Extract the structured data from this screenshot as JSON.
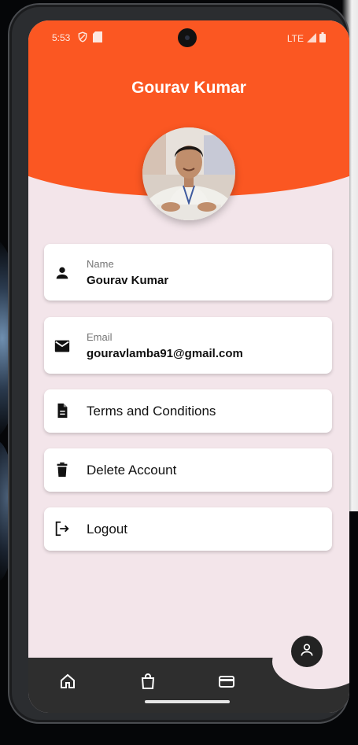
{
  "status_bar": {
    "time": "5:53",
    "network": "LTE"
  },
  "profile": {
    "title": "Gourav Kumar"
  },
  "cards": {
    "name": {
      "label": "Name",
      "value": "Gourav Kumar"
    },
    "email": {
      "label": "Email",
      "value": "gouravlamba91@gmail.com"
    },
    "terms": {
      "label": "Terms and Conditions"
    },
    "delete": {
      "label": "Delete Account"
    },
    "logout": {
      "label": "Logout"
    }
  },
  "bottom_nav": {
    "items": [
      "home-icon",
      "shopping-bag-icon",
      "wallet-icon",
      "profile-icon"
    ],
    "active": "profile-icon"
  },
  "colors": {
    "accent": "#fb5722",
    "background": "#f3e5ea",
    "nav": "#2e2e2e"
  }
}
